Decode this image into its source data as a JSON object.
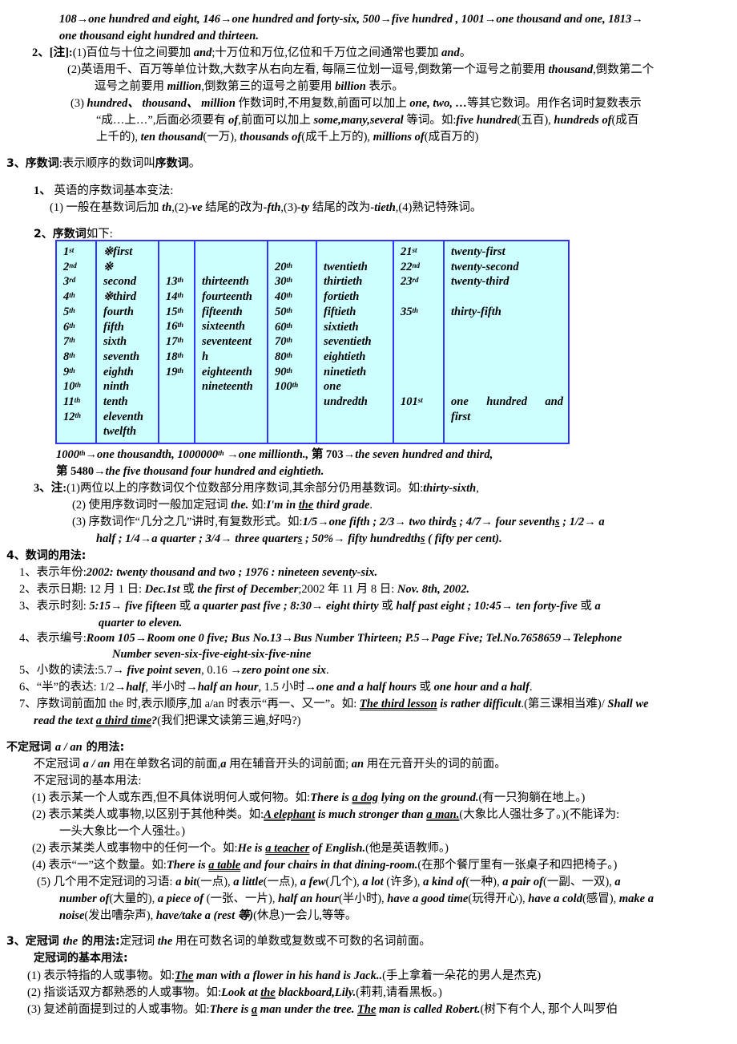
{
  "cardinal_examples": {
    "line1": "108→one hundred and eight, 146→one hundred and forty-six, 500→five hundred , 1001→one thousand and one, 1813→",
    "line2": "one thousand eight hundred and thirteen."
  },
  "cardinal_notes": {
    "label": "2、[注]:",
    "note1_a": "(1)百位与十位之间要加 ",
    "note1_and1": "and",
    "note1_b": ";十万位和万位,亿位和千万位之间通常也要加 ",
    "note1_and2": "and",
    "note1_c": "。",
    "note2_a": "(2)英语用千、百万等单位计数,大数字从右向左看, 每隔三位划一逗号,倒数第一个逗号之前要用 ",
    "note2_thousand": "thousand",
    "note2_b": ",倒数第二个",
    "note2_c": "逗号之前要用 ",
    "note2_million": "million",
    "note2_d": ",倒数第三的逗号之前要用 ",
    "note2_billion": "billion",
    "note2_e": " 表示。",
    "note3_a": "(3) ",
    "note3_words": "hundred、 thousand、 million",
    "note3_b": " 作数词时,不用复数,前面可以加上 ",
    "note3_nums": "one, two, …",
    "note3_c": "等其它数词。用作名词时复数表示",
    "note3_d": "“成…上…”,后面必须要有 ",
    "note3_of": "of",
    "note3_e": ",前面可以加上 ",
    "note3_some": "some,many,several",
    "note3_f": " 等词。如:",
    "note3_ex1": "five hundred",
    "note3_ex1_cn": "(五百), ",
    "note3_ex2": "hundreds of",
    "note3_ex2_cn": "(成百",
    "note3_g": "上千的), ",
    "note3_ex3": "ten thousand",
    "note3_ex3_cn": "(一万), ",
    "note3_ex4": "thousands of",
    "note3_ex4_cn": "(成千上万的), ",
    "note3_ex5": "millions of",
    "note3_ex5_cn": "(成百万的)"
  },
  "ordinals": {
    "heading_num": "3、序数词",
    "heading_rest": ":表示顺序的数词叫",
    "heading_bold": "序数词",
    "heading_end": "。",
    "sub1_label": "1、",
    "sub1_text": " 英语的序数词基本变法:",
    "rule_a": "(1) 一般在基数词后加 ",
    "rule_th": "th",
    "rule_b": ",(2)",
    "rule_ve": "-ve",
    "rule_c": " 结尾的改为",
    "rule_fth": "-fth",
    "rule_d": ",(3)",
    "rule_ty": "-ty",
    "rule_e": " 结尾的改为",
    "rule_tieth": "-tieth",
    "rule_f": ",(4)熟记特殊词。",
    "sub2_label": "2、序数词",
    "sub2_text": "如下:",
    "table": {
      "col1": [
        [
          "1",
          "st"
        ],
        [
          "2",
          "nd"
        ],
        [
          "3",
          "rd"
        ],
        [
          "4",
          "th"
        ],
        [
          "5",
          "th"
        ],
        [
          "6",
          "th"
        ],
        [
          "7",
          "th"
        ],
        [
          "8",
          "th"
        ],
        [
          "9",
          "th"
        ],
        [
          "10",
          "th"
        ],
        [
          "11",
          "th"
        ],
        [
          "12",
          "th"
        ]
      ],
      "col2": [
        "※first",
        "※",
        "second",
        "※third",
        "fourth",
        "fifth",
        "sixth",
        "seventh",
        "eighth",
        "ninth",
        "tenth",
        "eleventh",
        "twelfth"
      ],
      "col3": [
        [
          "13",
          "th"
        ],
        [
          "14",
          "th"
        ],
        [
          "15",
          "th"
        ],
        [
          "16",
          "th"
        ],
        [
          "17",
          "th"
        ],
        [
          "18",
          "th"
        ],
        [
          "19",
          "th"
        ]
      ],
      "col4": [
        "thirteenth",
        "fourteenth",
        "fifteenth",
        "sixteenth",
        "seventeent",
        "h",
        "eighteenth",
        "nineteenth"
      ],
      "col5": [
        [
          "20",
          "th"
        ],
        [
          "30",
          "th"
        ],
        [
          "40",
          "th"
        ],
        [
          "50",
          "th"
        ],
        [
          "60",
          "th"
        ],
        [
          "70",
          "th"
        ],
        [
          "80",
          "th"
        ],
        [
          "90",
          "th"
        ],
        [
          "100",
          "th"
        ]
      ],
      "col6": [
        "twentieth",
        "thirtieth",
        "fortieth",
        "fiftieth",
        "sixtieth",
        "seventieth",
        "eightieth",
        "ninetieth",
        "one",
        "undredth"
      ],
      "col7": {
        "r1": [
          "21",
          "st"
        ],
        "r2": [
          "22",
          "nd"
        ],
        "r3": [
          "23",
          "rd"
        ],
        "r5": [
          "35",
          "th"
        ],
        "r11": [
          "101",
          "st"
        ]
      },
      "col8": {
        "r1": "twenty-first",
        "r2": "twenty-second",
        "r3": "twenty-third",
        "r5": "thirty-fifth",
        "r11": [
          "one",
          "hundred",
          "and"
        ],
        "r12": "first"
      }
    },
    "after_table_1": {
      "a": "1000",
      "a_sup": "th",
      "a2": "→one thousandth,    1000000",
      "b_sup": "th",
      "b": " →one millionth., ",
      "c": "第 703",
      "d": "→the seven hundred and third,"
    },
    "after_table_2": {
      "a": "第 5480",
      "b": "→the five thousand four hundred and eightieth."
    },
    "note_label": "3、注:",
    "note1_a": "(1)两位以上的序数词仅个位数部分用序数词,其余部分仍用基数词。如:",
    "note1_ex": "thirty-sixth",
    "note1_end": ",",
    "note2_a": "(2) 使用序数词时一般加定冠词 ",
    "note2_the": "the.",
    "note2_b": " 如:",
    "note2_ex_a": "I'm in ",
    "note2_ex_the": "the",
    "note2_ex_b": " third grade",
    "note2_end": ".",
    "note3_a": "(3) 序数词作“几分之几”讲时,有复数形式。如:",
    "note3_ex1": "1/5→one fifth ; 2/3→  two third",
    "s1": "s",
    "note3_ex2": " ; 4/7→  four seventh",
    "s2": "s",
    "note3_ex3": " ; 1/2→  a",
    "note3_ex4": "half ; 1/4→a quarter ; 3/4→  three quarter",
    "s3": "s",
    "note3_ex5": " ; 50%→  fifty hundredth",
    "s4": "s",
    "note3_ex6": " ( fifty per cent)."
  },
  "usage": {
    "heading": "4、数词的用法:",
    "items": [
      {
        "label": "1、表示年份:",
        "text": "2002: twenty thousand and two ; 1976 : nineteen seventy-six."
      },
      {
        "label": "2、表示日期:",
        "cn1": "  12 月 1 日: ",
        "en1": "Dec.1st",
        "or": " 或 ",
        "en2": "the first of December",
        "cn2": ";2002 年 11 月 8 日: ",
        "en3": "Nov. 8th, 2002."
      },
      {
        "label": "3、表示时刻:",
        "en1": "  5:15→  five fifteen",
        "or1": " 或 ",
        "en2": "a quarter past five ; 8:30→  eight thirty",
        "or2": " 或 ",
        "en3": "half past eight ; 10:45→  ten forty-five",
        "or3": " 或 ",
        "en4": "a",
        "en5": "quarter to eleven."
      },
      {
        "label": "4、表示编号:",
        "text": "Room 105→Room one 0 five; Bus No.13→Bus Number Thirteen; P.5→Page Five; Tel.No.7658659→Telephone",
        "text2": "Number seven-six-five-eight-six-five-nine"
      },
      {
        "label": "5、小数的读法:",
        "cn1": "5.7→  ",
        "en1": "five point seven",
        "cn2": ",    0.16  →",
        "en2": "zero point one six",
        "end": "."
      },
      {
        "label": "6、“半”的表达:",
        "cn1": "  1/2→",
        "en1": "half",
        "cn2": ", 半小时→",
        "en2": "half an hour",
        "cn3": ", 1.5 小时→",
        "en3": "one and a half hours",
        "or": " 或 ",
        "en4": "one hour and a half",
        "end": "."
      },
      {
        "label": "7、序数词前面加 the 时,表示顺序,加 a/an 时表示“再一、又一”。如: ",
        "en1": "The third lesson",
        "en2": " is rather difficult",
        "cn1": ".(第三课相当难)/ ",
        "en3": "Shall we",
        "en4": "read the text ",
        "en5": "a third time",
        "en6": "?",
        "cn2": "(我们把课文读第三遍,好吗?)"
      }
    ]
  },
  "indefinite": {
    "heading_a": "不定冠词 ",
    "heading_en": "a / an",
    "heading_b": " 的用法:",
    "intro_a": "不定冠词 ",
    "intro_en": "a / an",
    "intro_b": " 用在单数名词的前面,",
    "intro_a2": "a",
    "intro_c": " 用在辅音开头的词前面; ",
    "intro_an": "an",
    "intro_d": " 用在元音开头的词的前面。",
    "basic": "不定冠词的基本用法:",
    "i1_a": "(1)  表示某一个人或东西,但不具体说明何人或何物。如:",
    "i1_e1": "There is ",
    "i1_u": "a dog",
    "i1_e2": " lying on the ground.",
    "i1_cn": "(有一只狗躺在地上。)",
    "i2_a": "(2)  表示某类人或事物,以区别于其他种类。如:",
    "i2_u1": "A elephant",
    "i2_e1": " is much stronger than ",
    "i2_u2": "a man.",
    "i2_cn": "(大象比人强壮多了。)(不能译为:",
    "i2_cn2": "一头大象比一个人强壮。)",
    "i3_a": "(2)  表示某类人或事物中的任何一个。如:",
    "i3_e1": "He is ",
    "i3_u": "a teacher",
    "i3_e2": " of English.",
    "i3_cn": "(他是英语教师。)",
    "i4_a": "(4)  表示“一”这个数量。如:",
    "i4_e1": "There is ",
    "i4_u": "a table",
    "i4_e2": " and four chairs in that dining-room.",
    "i4_cn": "(在那个餐厅里有一张桌子和四把椅子。)",
    "i5_a": "(5)  几个用不定冠词的习语:",
    "i5_l1": [
      [
        "a bit",
        "(一点), "
      ],
      [
        "a little",
        "(一点), "
      ],
      [
        "a few",
        "(几个), "
      ],
      [
        "a lot",
        " (许多), "
      ],
      [
        "a kind of",
        "(一种), "
      ],
      [
        "a pair of",
        "(一副、一双), "
      ],
      [
        "a",
        ""
      ]
    ],
    "i5_l2": [
      [
        "number of",
        "(大量的), "
      ],
      [
        "a piece of",
        " (一张、一片), "
      ],
      [
        "half an hour",
        "(半小时), "
      ],
      [
        "have a good time",
        "(玩得开心), "
      ],
      [
        "have a cold",
        "(感冒), "
      ],
      [
        "make a",
        ""
      ]
    ],
    "i5_l3": [
      [
        "noise",
        "(发出嘈杂声), "
      ],
      [
        "have/take a (rest 等)",
        "(休息)一会儿,等等。"
      ]
    ]
  },
  "definite": {
    "heading_a": "3、定冠词 ",
    "heading_en": "the",
    "heading_b": " 的用法:",
    "heading_c": "定冠词 ",
    "heading_en2": "the",
    "heading_d": " 用在可数名词的单数或复数或不可数的名词前面。",
    "basic": "定冠词的基本用法:",
    "i1_a": "(1)  表示特指的人或事物。如:",
    "i1_u": "The",
    "i1_e": " man with a flower in his hand is Jack..",
    "i1_cn": "(手上拿着一朵花的男人是杰克)",
    "i2_a": "(2)  指谈话双方都熟悉的人或事物。如:",
    "i2_e1": "Look at ",
    "i2_u": "the",
    "i2_e2": " blackboard,Lily.",
    "i2_cn": "(莉莉,请看黑板。)",
    "i3_a": "(3)  复述前面提到过的人或事物。如:",
    "i3_e1": "There is ",
    "i3_u1": "a",
    "i3_e2": " man under the tree. ",
    "i3_u2": "The",
    "i3_e3": " man is called Robert.",
    "i3_cn": "(树下有个人,   那个人叫罗伯"
  }
}
